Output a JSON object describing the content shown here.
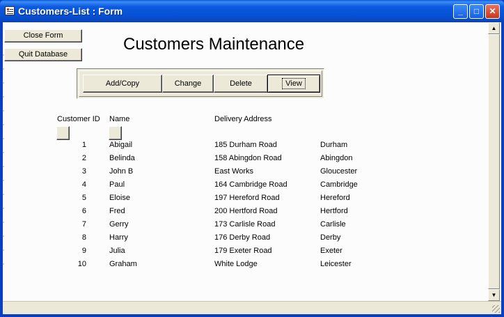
{
  "window": {
    "title": "Customers-List : Form"
  },
  "title_controls": {
    "minimize": "_",
    "maximize": "□",
    "close": "✕"
  },
  "buttons": {
    "close_form": "Close Form",
    "quit_database": "Quit Database"
  },
  "heading": "Customers Maintenance",
  "actions": {
    "add_copy": "Add/Copy",
    "change": "Change",
    "delete": "Delete",
    "view": "View"
  },
  "columns": {
    "customer_id": "Customer ID",
    "name": "Name",
    "delivery_address": "Delivery Address"
  },
  "rows": [
    {
      "id": "1",
      "name": "Abigail",
      "address": "185 Durham Road",
      "town": "Durham"
    },
    {
      "id": "2",
      "name": "Belinda",
      "address": "158 Abingdon Road",
      "town": "Abingdon"
    },
    {
      "id": "3",
      "name": "John B",
      "address": "East Works",
      "town": "Gloucester"
    },
    {
      "id": "4",
      "name": "Paul",
      "address": "164 Cambridge Road",
      "town": "Cambridge"
    },
    {
      "id": "5",
      "name": "Eloise",
      "address": "197 Hereford Road",
      "town": "Hereford"
    },
    {
      "id": "6",
      "name": "Fred",
      "address": "200 Hertford Road",
      "town": "Hertford"
    },
    {
      "id": "7",
      "name": "Gerry",
      "address": "173 Carlisle Road",
      "town": "Carlisle"
    },
    {
      "id": "8",
      "name": "Harry",
      "address": "176 Derby Road",
      "town": "Derby"
    },
    {
      "id": "9",
      "name": "Julia",
      "address": "179 Exeter Road",
      "town": "Exeter"
    },
    {
      "id": "10",
      "name": "Graham",
      "address": "White Lodge",
      "town": "Leicester"
    }
  ],
  "scrollbar": {
    "up_arrow": "▲",
    "down_arrow": "▼"
  }
}
